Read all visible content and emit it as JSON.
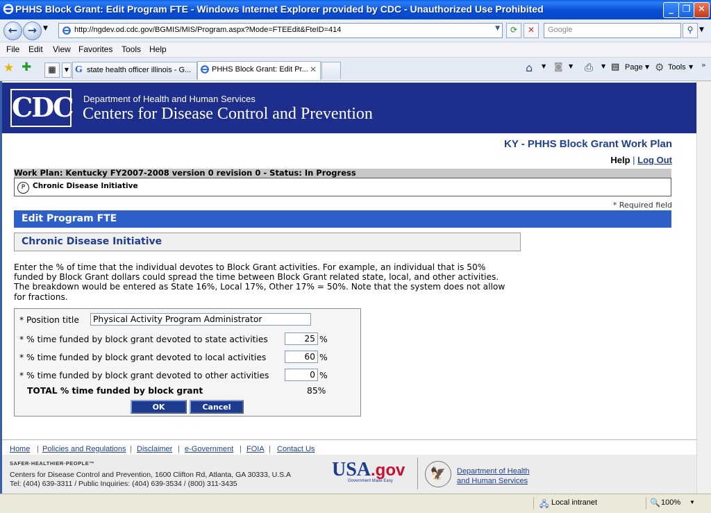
{
  "window": {
    "title": "PHHS Block Grant: Edit Program FTE - Windows Internet Explorer provided by CDC - Unauthorized Use Prohibited"
  },
  "browser": {
    "url": "http://ngdev.od.cdc.gov/BGMIS/MIS/Program.aspx?Mode=FTEEdit&FteID=414",
    "search_placeholder": "Google",
    "menu": [
      "File",
      "Edit",
      "View",
      "Favorites",
      "Tools",
      "Help"
    ],
    "tabs": [
      {
        "label": "state health officer illinois - G..."
      },
      {
        "label": "PHHS Block Grant: Edit Pr..."
      }
    ],
    "toolbar": {
      "page_label": "Page",
      "tools_label": "Tools"
    }
  },
  "header": {
    "logo_text": "CDC",
    "department": "Department of Health and Human Services",
    "agency": "Centers for Disease Control and Prevention",
    "work_plan_title": "KY - PHHS Block Grant Work Plan",
    "help_label": "Help",
    "separator": "|",
    "logout_label": "Log Out"
  },
  "work_plan": {
    "status_line": "Work Plan: Kentucky FY2007-2008 version 0 revision 0 - Status: In Progress",
    "program_icon_letter": "P",
    "program_name": "Chronic Disease Initiative"
  },
  "page": {
    "required_note": "* Required field",
    "section_title": "Edit Program FTE",
    "program_title": "Chronic Disease Initiative",
    "instructions": "Enter the % of time that the individual devotes to Block Grant activities. For example, an individual that is 50% funded by Block Grant dollars could spread the time between Block Grant related state, local, and other activities. The breakdown would be entered as State 16%, Local 17%, Other 17% = 50%. Note that the system does not allow for fractions."
  },
  "form": {
    "position_label": "* Position title",
    "position_value": "Physical Activity Program Administrator",
    "state_label": "* % time funded by block grant devoted to state activities",
    "state_value": "25",
    "local_label": "* % time funded by block grant devoted to local activities",
    "local_value": "60",
    "other_label": "* % time funded by block grant devoted to other activities",
    "other_value": "0",
    "percent_sign": "%",
    "total_label": "TOTAL % time funded by block grant",
    "total_value": "85%",
    "ok_label": "OK",
    "cancel_label": "Cancel"
  },
  "footer": {
    "links": [
      "Home",
      "Policies and Regulations",
      "Disclaimer",
      "e-Government",
      "FOIA",
      "Contact Us"
    ],
    "tagline": "SAFER·HEALTHIER·PEOPLE™",
    "address": "Centers for Disease Control and Prevention, 1600 Clifton Rd, Atlanta, GA 30333, U.S.A",
    "phone": "Tel: (404) 639-3311 / Public Inquiries: (404) 639-3534 / (800) 311-3435",
    "usagov_usa": "USA",
    "usagov_gov": ".gov",
    "usagov_tag": "Government Made Easy",
    "hhs_line1": "Department of Health",
    "hhs_line2": "and Human Services"
  },
  "statusbar": {
    "zone": "Local intranet",
    "zoom": "100%"
  },
  "colors": {
    "banner": "#1d2e8c",
    "section_bar": "#2f5fc8",
    "link": "#1f3f8f",
    "button": "#1d3c8f"
  }
}
